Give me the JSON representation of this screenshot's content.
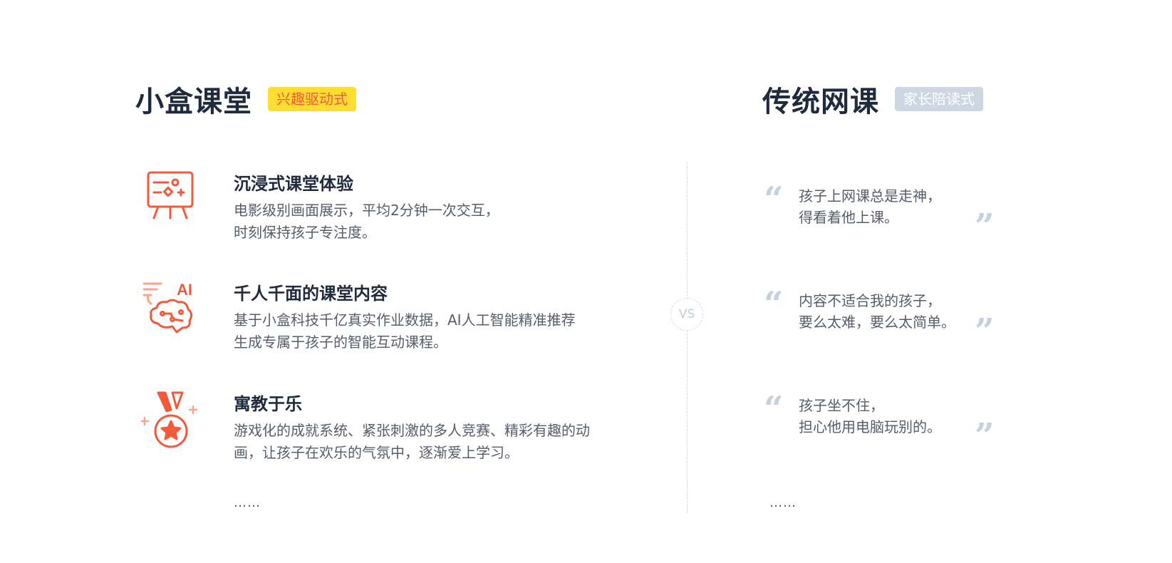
{
  "left": {
    "title": "小盒课堂",
    "tag": "兴趣驱动式",
    "features": [
      {
        "icon": "presentation-board-icon",
        "title": "沉浸式课堂体验",
        "line1": "电影级别画面展示，平均2分钟一次交互，",
        "line2": "时刻保持孩子专注度。"
      },
      {
        "icon": "ai-brain-icon",
        "title": "千人千面的课堂内容",
        "line1": "基于小盒科技千亿真实作业数据，AI人工智能精准推荐",
        "line2": "生成专属于孩子的智能互动课程。"
      },
      {
        "icon": "medal-icon",
        "title": "寓教于乐",
        "line1": "游戏化的成就系统、紧张刺激的多人竞赛、精彩有趣的动",
        "line2": "画，让孩子在欢乐的气氛中，逐渐爱上学习。"
      }
    ],
    "more": "……"
  },
  "vs": "VS",
  "right": {
    "title": "传统网课",
    "tag": "家长陪读式",
    "quotes": [
      {
        "line1": "孩子上网课总是走神，",
        "line2": "得看着他上课。"
      },
      {
        "line1": "内容不适合我的孩子，",
        "line2": "要么太难，要么太简单。"
      },
      {
        "line1": "孩子坐不住，",
        "line2": "担心他用电脑玩别的。"
      }
    ],
    "more": "……"
  },
  "colors": {
    "accent": "#f25a3a",
    "tag_yellow": "#ffdd33",
    "tag_gray": "#ccd7e2",
    "quote_mark": "#c5d1dc",
    "heading": "#1f2a3c",
    "body": "#555d6b"
  }
}
